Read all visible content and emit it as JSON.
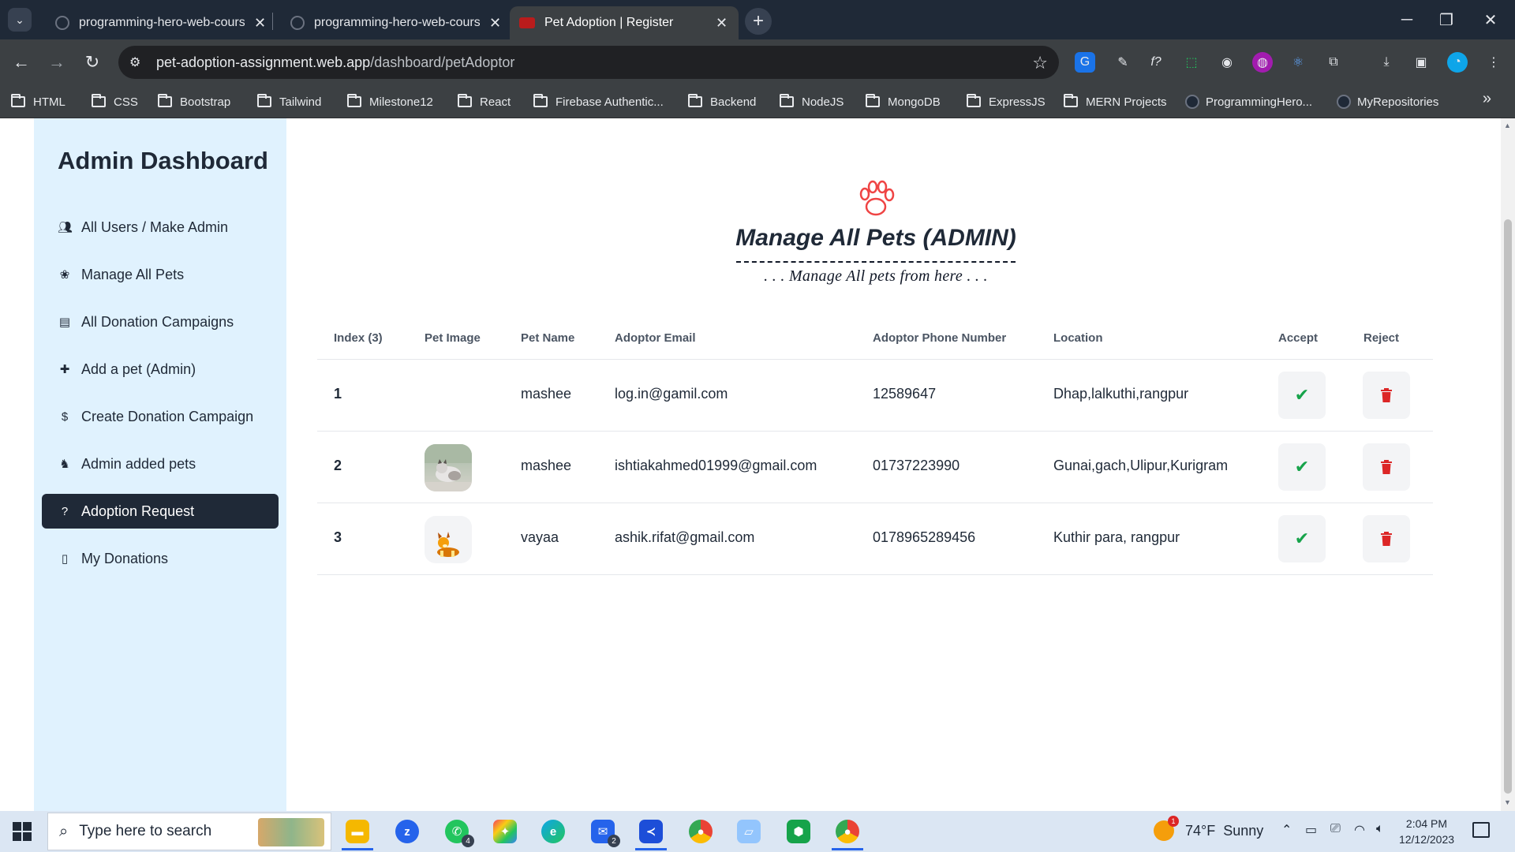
{
  "browser": {
    "tabs": [
      {
        "title": "programming-hero-web-course"
      },
      {
        "title": "programming-hero-web-course"
      },
      {
        "title": "Pet Adoption | Register"
      }
    ],
    "url_domain": "pet-adoption-assignment.web.app",
    "url_path": "/dashboard/petAdoptor",
    "bookmarks": [
      "HTML",
      "CSS",
      "Bootstrap",
      "Tailwind",
      "Milestone12",
      "React",
      "Firebase Authentic...",
      "Backend",
      "NodeJS",
      "MongoDB",
      "ExpressJS",
      "MERN Projects",
      "ProgrammingHero...",
      "MyRepositories"
    ]
  },
  "sidebar": {
    "title": "Admin Dashboard",
    "items": [
      {
        "label": "All Users / Make Admin",
        "icon": "users-icon"
      },
      {
        "label": "Manage All Pets",
        "icon": "paw-icon"
      },
      {
        "label": "All Donation Campaigns",
        "icon": "ticket-icon"
      },
      {
        "label": "Add a pet (Admin)",
        "icon": "add-pet-icon"
      },
      {
        "label": "Create Donation Campaign",
        "icon": "dollar-icon"
      },
      {
        "label": "Admin added pets",
        "icon": "dog-icon"
      },
      {
        "label": "Adoption Request",
        "icon": "question-icon",
        "active": true
      },
      {
        "label": "My Donations",
        "icon": "document-icon"
      }
    ]
  },
  "main": {
    "heading": "Manage All Pets (ADMIN)",
    "subheading": ". . . Manage All pets from here . . .",
    "columns": [
      "Index (3)",
      "Pet Image",
      "Pet Name",
      "Adoptor Email",
      "Adoptor Phone Number",
      "Location",
      "Accept",
      "Reject"
    ],
    "rows": [
      {
        "index": "1",
        "image": "none",
        "name": "mashee",
        "email": "log.in@gamil.com",
        "phone": "12589647",
        "location": "Dhap,lalkuthi,rangpur"
      },
      {
        "index": "2",
        "image": "cat-photo",
        "name": "mashee",
        "email": "ishtiakahmed01999@gmail.com",
        "phone": "01737223990",
        "location": "Gunai,gach,Ulipur,Kurigram"
      },
      {
        "index": "3",
        "image": "dog-photo",
        "name": "vayaa",
        "email": "ashik.rifat@gmail.com",
        "phone": "0178965289456",
        "location": "Kuthir para, rangpur"
      }
    ]
  },
  "taskbar": {
    "search_placeholder": "Type here to search",
    "weather": "74°F  Sunny",
    "weather_badge": "1",
    "time": "2:04 PM",
    "date": "12/12/2023",
    "whatsapp_badge": "4",
    "mail_badge": "2"
  },
  "colors": {
    "sidebar_bg": "#e0f2fe",
    "active_item_bg": "#1f2937",
    "accept": "#16a34a",
    "reject": "#dc2626",
    "paw": "#ef4444"
  }
}
